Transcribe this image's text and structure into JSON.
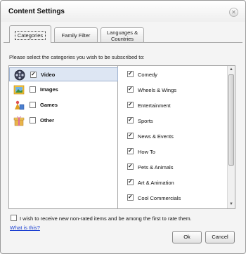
{
  "window": {
    "title": "Content Settings"
  },
  "tabs": [
    {
      "label": "Categories",
      "active": true
    },
    {
      "label": "Family Filter",
      "active": false
    },
    {
      "label_line1": "Languages &",
      "label_line2": "Countries",
      "active": false
    }
  ],
  "instructions": "Please select the categories you wish to be subscribed to:",
  "categories": [
    {
      "label": "Video",
      "checked": true,
      "selected": true,
      "icon": "film-reel-icon"
    },
    {
      "label": "Images",
      "checked": false,
      "selected": false,
      "icon": "picture-icon"
    },
    {
      "label": "Games",
      "checked": false,
      "selected": false,
      "icon": "game-pieces-icon"
    },
    {
      "label": "Other",
      "checked": false,
      "selected": false,
      "icon": "gift-box-icon"
    }
  ],
  "subcategories": [
    {
      "label": "Comedy",
      "checked": true
    },
    {
      "label": "Wheels & Wings",
      "checked": true
    },
    {
      "label": "Entertainment",
      "checked": true
    },
    {
      "label": "Sports",
      "checked": true
    },
    {
      "label": "News & Events",
      "checked": true
    },
    {
      "label": "How To",
      "checked": true
    },
    {
      "label": "Pets & Animals",
      "checked": true
    },
    {
      "label": "Art & Animation",
      "checked": true
    },
    {
      "label": "Cool Commercials",
      "checked": true
    }
  ],
  "optin": {
    "label": "I wish to receive new non-rated items and be among the first to rate them.",
    "checked": false
  },
  "link": {
    "label": "What is this?"
  },
  "buttons": {
    "ok": "Ok",
    "cancel": "Cancel"
  },
  "colors": {
    "selection": "#dde6f3",
    "link": "#1a3fd1"
  }
}
